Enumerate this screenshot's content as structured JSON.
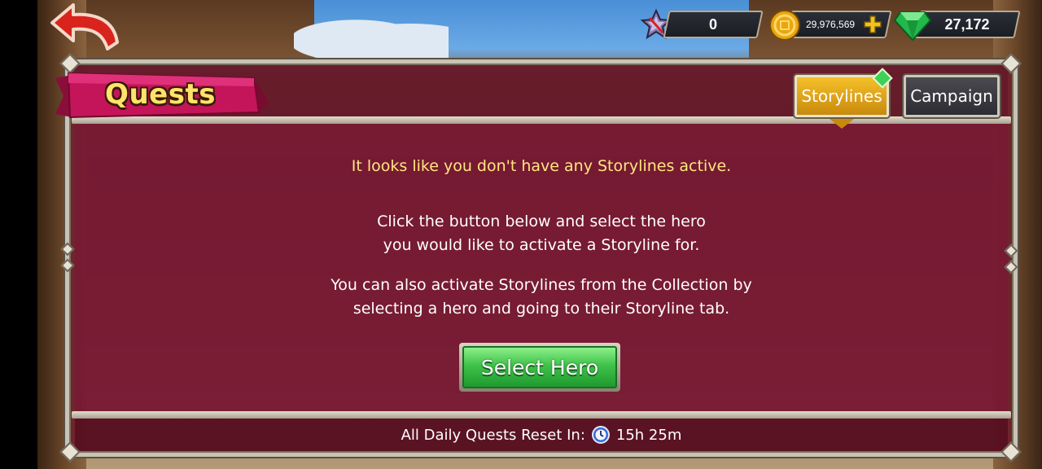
{
  "header": {
    "back_label": "Back",
    "currencies": [
      {
        "name": "tokens",
        "value": "0",
        "icon": "star-badge-icon"
      },
      {
        "name": "gold",
        "value": "29,976,569",
        "icon": "gold-coin-icon"
      },
      {
        "name": "gems",
        "value": "27,172",
        "icon": "gem-icon"
      }
    ]
  },
  "panel": {
    "title": "Quests",
    "tabs": [
      {
        "label": "Storylines",
        "active": true
      },
      {
        "label": "Campaign",
        "active": false
      }
    ],
    "message_highlight": "It looks like you don't have any Storylines active.",
    "message_1_line1": "Click the button below and select the hero",
    "message_1_line2": "you would like to activate a Storyline for.",
    "message_2_line1": "You can also activate Storylines from the Collection by",
    "message_2_line2": "selecting a hero and going to their Storyline tab.",
    "button_label": "Select Hero",
    "footer_label": "All Daily Quests Reset In:",
    "footer_time": "15h 25m"
  },
  "colors": {
    "panel_bg": "#6e182c",
    "highlight_text": "#ffe680",
    "active_tab": "#f4c02a",
    "button_green": "#3fc24a"
  }
}
